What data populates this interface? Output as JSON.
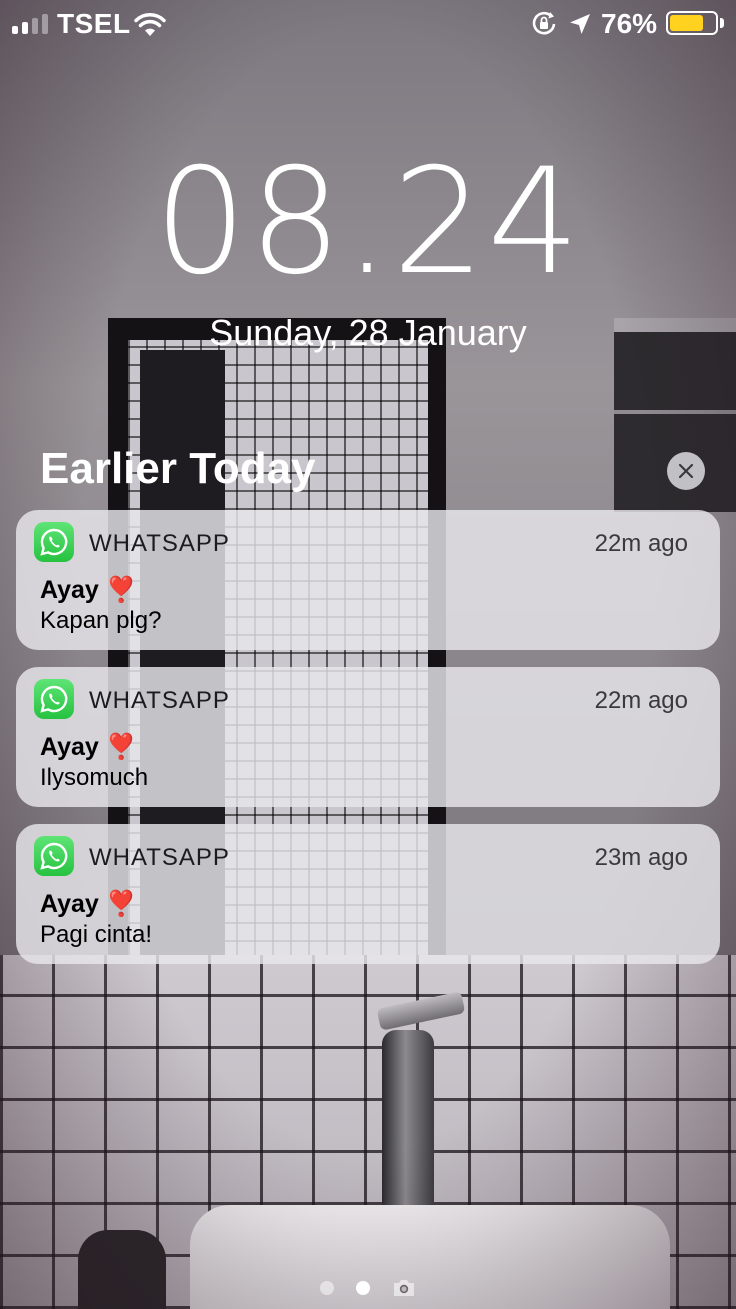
{
  "status_bar": {
    "carrier": "TSEL",
    "battery_percent": "76%",
    "battery_level": 0.76,
    "signal_bars_filled": 2,
    "signal_bars_total": 4,
    "icons": [
      "wifi-icon",
      "rotation-lock-icon",
      "location-arrow-icon",
      "battery-icon"
    ],
    "battery_color": "#ffd21f"
  },
  "lock_screen": {
    "time": "08.24",
    "date": "Sunday, 28 January"
  },
  "notification_center": {
    "section_title": "Earlier Today",
    "clear_icon": "close-icon",
    "notifications": [
      {
        "app": "WHATSAPP",
        "time": "22m ago",
        "sender": "Ayay ❣️",
        "message": "Kapan plg?"
      },
      {
        "app": "WHATSAPP",
        "time": "22m ago",
        "sender": "Ayay ❣️",
        "message": "Ilysomuch"
      },
      {
        "app": "WHATSAPP",
        "time": "23m ago",
        "sender": "Ayay ❣️",
        "message": "Pagi cinta!"
      }
    ],
    "app_icon": "whatsapp-icon",
    "app_color": "#26c240"
  },
  "page_indicator": {
    "pages": 2,
    "active_page": 2,
    "trailing_icon": "camera-icon"
  }
}
